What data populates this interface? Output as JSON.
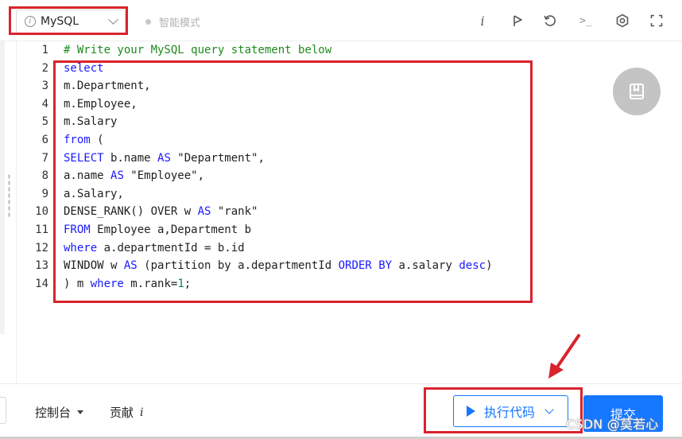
{
  "toolbar": {
    "language": "MySQL",
    "smart_mode": "智能模式",
    "icons": [
      "info-icon",
      "flag-icon",
      "reset-icon",
      "terminal-icon",
      "settings-icon",
      "fullscreen-icon"
    ],
    "info_glyph": "i",
    "terminal_glyph": ">_"
  },
  "editor": {
    "line_numbers": [
      "1",
      "2",
      "3",
      "4",
      "5",
      "6",
      "7",
      "8",
      "9",
      "10",
      "11",
      "12",
      "13",
      "14"
    ],
    "lines": [
      "# Write your MySQL query statement below",
      "select",
      "m.Department,",
      "m.Employee,",
      "m.Salary",
      "from (",
      "SELECT b.name AS \"Department\",",
      "a.name AS \"Employee\",",
      "a.Salary,",
      "DENSE_RANK() OVER w AS \"rank\"",
      "FROM Employee a,Department b",
      "where a.departmentId = b.id",
      "WINDOW w AS (partition by a.departmentId ORDER BY a.salary desc)",
      ") m where m.rank=1;"
    ]
  },
  "bottom": {
    "console_label": "控制台",
    "contribute_label": "贡献",
    "contribute_glyph": "i",
    "run_label": "执行代码",
    "submit_label": "提交"
  },
  "watermark": "CSDN @莫若心",
  "colors": {
    "accent": "#1677ff",
    "annotation_red": "#d9232d",
    "keyword": "#1a1aff",
    "comment": "#1e8a1e"
  }
}
